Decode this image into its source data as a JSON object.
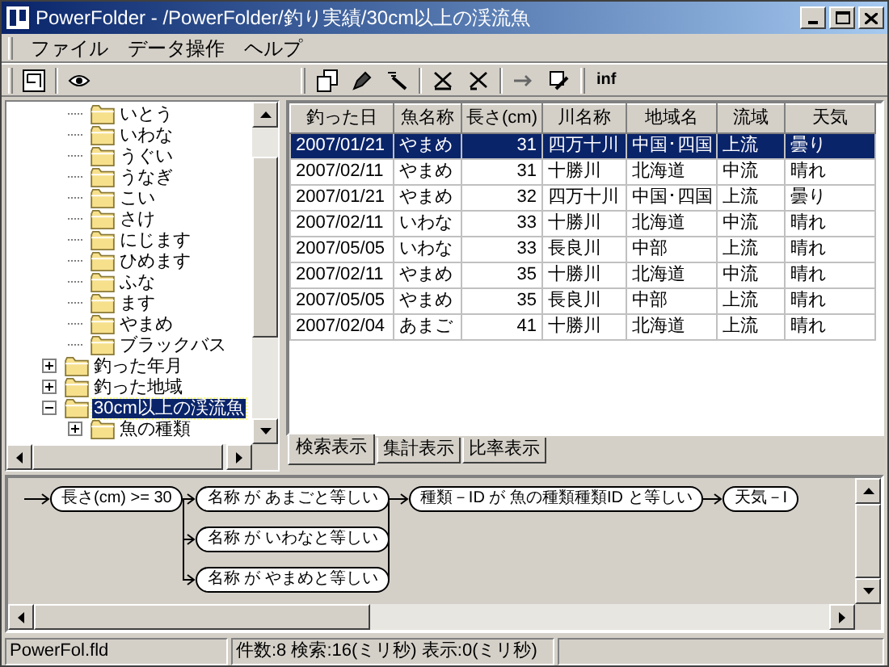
{
  "window": {
    "title": "PowerFolder - /PowerFolder/釣り実績/30cm以上の渓流魚"
  },
  "menu": [
    "ファイル",
    "データ操作",
    "ヘルプ"
  ],
  "toolbar": {
    "info_label": "inf"
  },
  "tree": [
    {
      "children": [
        {
          "label": "いとう",
          "selected": false
        },
        {
          "label": "いわな",
          "selected": false
        },
        {
          "label": "うぐい",
          "selected": false
        },
        {
          "label": "うなぎ",
          "selected": false
        },
        {
          "label": "こい",
          "selected": false
        },
        {
          "label": "さけ",
          "selected": false
        },
        {
          "label": "にじます",
          "selected": false
        },
        {
          "label": "ひめます",
          "selected": false
        },
        {
          "label": "ふな",
          "selected": false
        },
        {
          "label": "ます",
          "selected": false
        },
        {
          "label": "やまめ",
          "selected": false
        },
        {
          "label": "ブラックバス",
          "selected": false
        }
      ]
    },
    {
      "label": "釣った年月",
      "selected": false,
      "expanded": false
    },
    {
      "label": "釣った地域",
      "selected": false,
      "expanded": false
    },
    {
      "label": "30cm以上の渓流魚",
      "selected": true,
      "expanded": true,
      "children": [
        {
          "label": "魚の種類",
          "selected": false,
          "expanded": false
        }
      ]
    }
  ],
  "table": {
    "columns": [
      {
        "label": "釣った日",
        "kind": "text"
      },
      {
        "label": "魚名称",
        "kind": "text"
      },
      {
        "label": "長さ(cm)",
        "kind": "number"
      },
      {
        "label": "川名称",
        "kind": "text"
      },
      {
        "label": "地域名",
        "kind": "text"
      },
      {
        "label": "流域",
        "kind": "text"
      },
      {
        "label": "天気",
        "kind": "text"
      }
    ],
    "rows": [
      {
        "selected": true,
        "cells": [
          "2007/01/21",
          "やまめ",
          "31",
          "四万十川",
          "中国･四国",
          "上流",
          "曇り"
        ]
      },
      {
        "selected": false,
        "cells": [
          "2007/02/11",
          "やまめ",
          "31",
          "十勝川",
          "北海道",
          "中流",
          "晴れ"
        ]
      },
      {
        "selected": false,
        "cells": [
          "2007/01/21",
          "やまめ",
          "32",
          "四万十川",
          "中国･四国",
          "上流",
          "曇り"
        ]
      },
      {
        "selected": false,
        "cells": [
          "2007/02/11",
          "いわな",
          "33",
          "十勝川",
          "北海道",
          "中流",
          "晴れ"
        ]
      },
      {
        "selected": false,
        "cells": [
          "2007/05/05",
          "いわな",
          "33",
          "長良川",
          "中部",
          "上流",
          "晴れ"
        ]
      },
      {
        "selected": false,
        "cells": [
          "2007/02/11",
          "やまめ",
          "35",
          "十勝川",
          "北海道",
          "中流",
          "晴れ"
        ]
      },
      {
        "selected": false,
        "cells": [
          "2007/05/05",
          "やまめ",
          "35",
          "長良川",
          "中部",
          "上流",
          "晴れ"
        ]
      },
      {
        "selected": false,
        "cells": [
          "2007/02/04",
          "あまご",
          "41",
          "十勝川",
          "北海道",
          "上流",
          "晴れ"
        ]
      }
    ]
  },
  "tabs": [
    {
      "label": "検索表示",
      "selected": true
    },
    {
      "label": "集計表示",
      "selected": false
    },
    {
      "label": "比率表示",
      "selected": false
    }
  ],
  "query": [
    {
      "kind": "single",
      "text": "長さ(cm) >= 30"
    },
    {
      "kind": "or",
      "options": [
        "名称 が あまごと等しい",
        "名称 が いわなと等しい",
        "名称 が やまめと等しい"
      ]
    },
    {
      "kind": "single",
      "text": "種類－ID が 魚の種類種類ID と等しい"
    },
    {
      "kind": "single",
      "text": "天気－I"
    }
  ],
  "status_bar": [
    "PowerFol.fld",
    "件数:8  検索:16(ミリ秒)  表示:0(ミリ秒)"
  ]
}
